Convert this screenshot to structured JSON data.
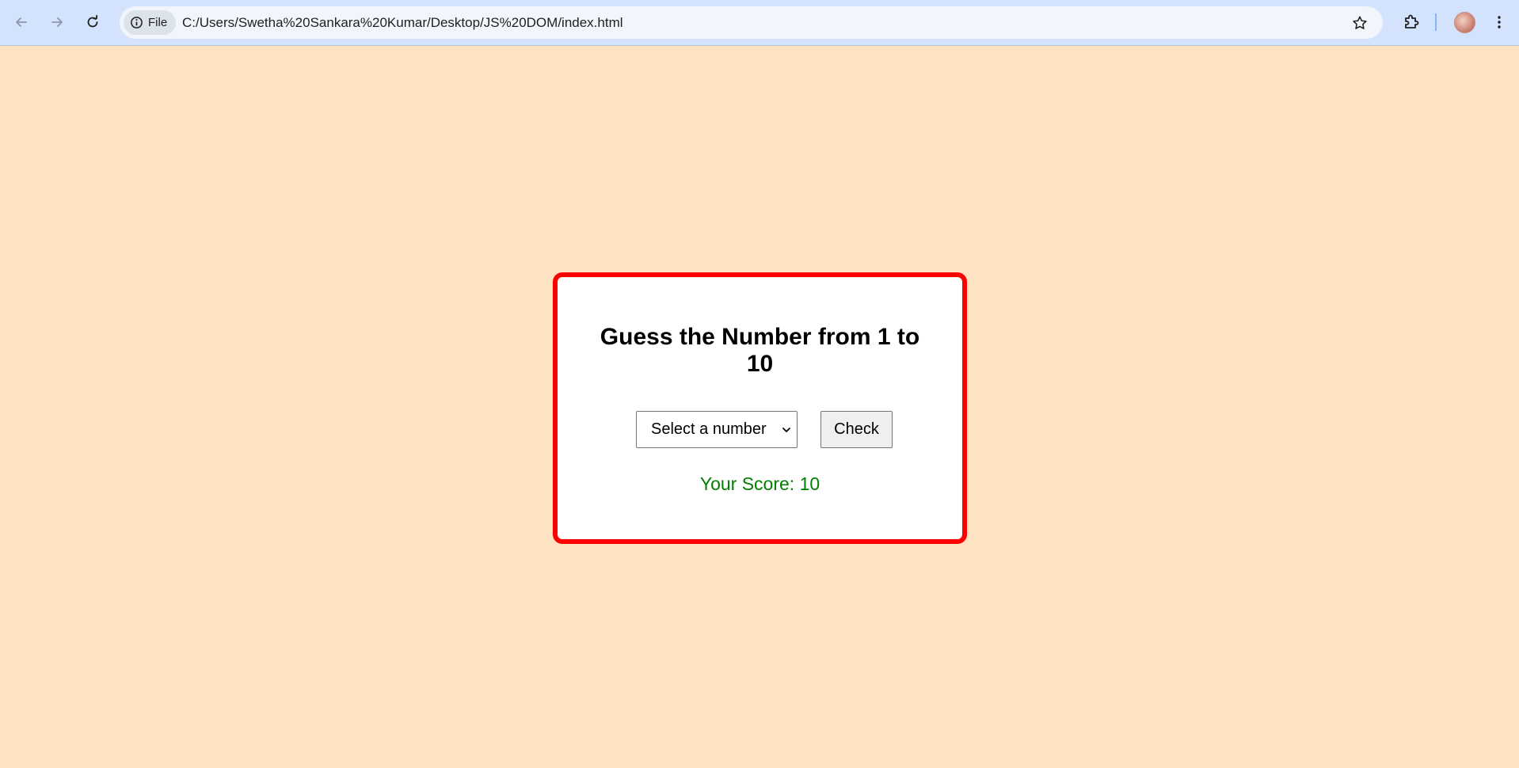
{
  "browser": {
    "site_chip_label": "File",
    "url": "C:/Users/Swetha%20Sankara%20Kumar/Desktop/JS%20DOM/index.html"
  },
  "colors": {
    "page_background": "#fde3c1",
    "card_border": "#fe0000",
    "score_text": "#008000",
    "chrome_background": "#d3e3fd"
  },
  "game": {
    "title": "Guess the Number from 1 to 10",
    "select_placeholder": "Select a number",
    "check_label": "Check",
    "score_text": "Your Score: 10"
  }
}
